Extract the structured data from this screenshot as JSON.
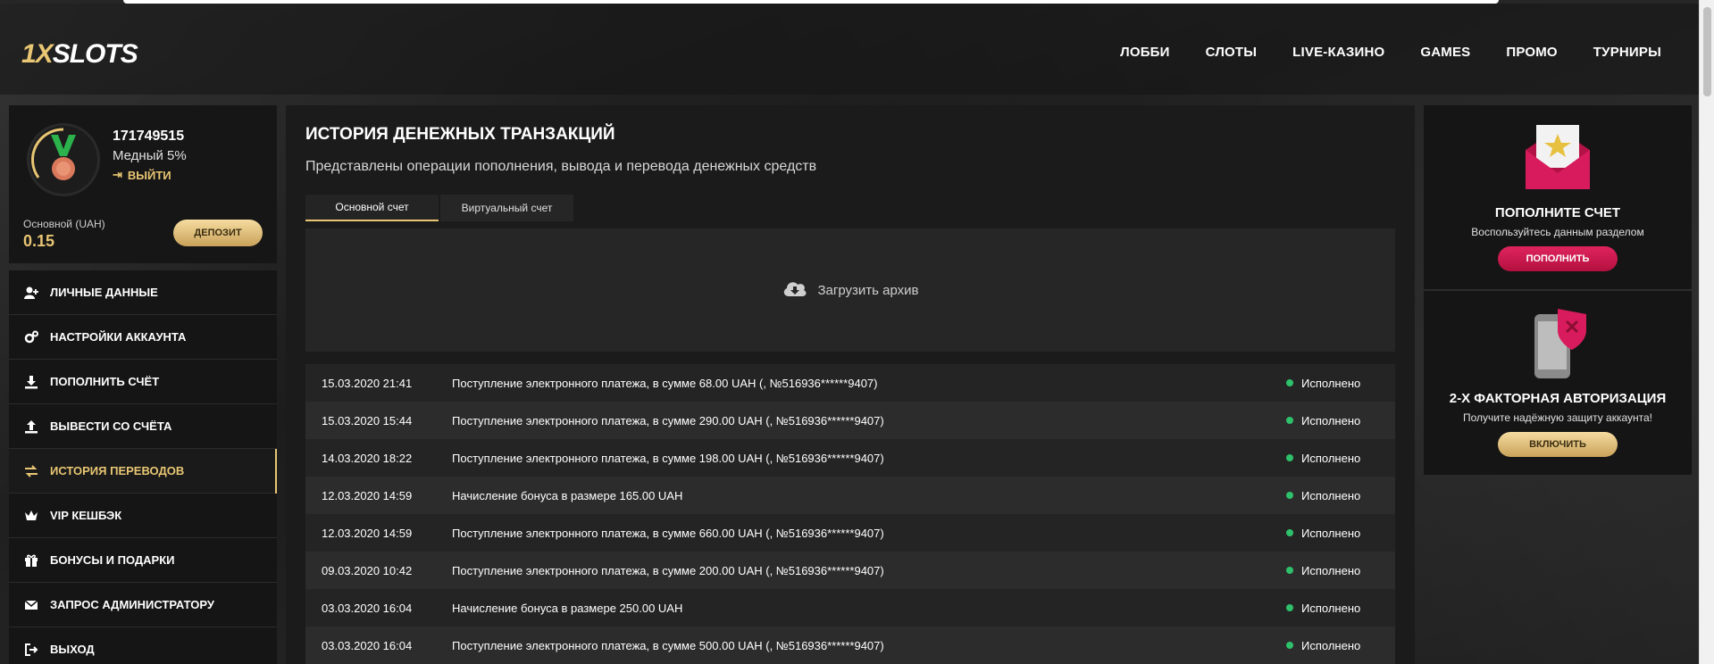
{
  "brand": {
    "logo_prefix": "1X",
    "logo_suffix": "SLOTS",
    "accent": "#e8c673"
  },
  "nav": [
    "ЛОББИ",
    "СЛОТЫ",
    "LIVE-КАЗИНО",
    "GAMES",
    "ПРОМО",
    "ТУРНИРЫ"
  ],
  "profile": {
    "user_id": "171749515",
    "level": "Медный 5%",
    "logout": "ВЫЙТИ",
    "balance_label": "Основной (UAH)",
    "balance_value": "0.15",
    "deposit_button": "ДЕПОЗИТ"
  },
  "menu": [
    {
      "label": "ЛИЧНЫЕ ДАННЫЕ",
      "icon": "user-plus-icon"
    },
    {
      "label": "НАСТРОЙКИ АККАУНТА",
      "icon": "gears-icon"
    },
    {
      "label": "ПОПОЛНИТЬ СЧЁТ",
      "icon": "download-icon"
    },
    {
      "label": "ВЫВЕСТИ СО СЧЁТА",
      "icon": "upload-icon"
    },
    {
      "label": "ИСТОРИЯ ПЕРЕВОДОВ",
      "icon": "exchange-icon",
      "active": true
    },
    {
      "label": "VIP КЕШБЭК",
      "icon": "crown-icon"
    },
    {
      "label": "БОНУСЫ И ПОДАРКИ",
      "icon": "gift-icon"
    },
    {
      "label": "ЗАПРОС АДМИНИСТРАТОРУ",
      "icon": "envelope-icon"
    },
    {
      "label": "ВЫХОД",
      "icon": "exit-icon"
    }
  ],
  "main": {
    "title": "ИСТОРИЯ ДЕНЕЖНЫХ ТРАНЗАКЦИЙ",
    "subtitle": "Представлены операции пополнения, вывода и перевода денежных средств",
    "tabs": [
      "Основной счет",
      "Виртуальный счет"
    ],
    "archive": "Загрузить архив",
    "transactions": [
      {
        "date": "15.03.2020 21:41",
        "desc": "Поступление электронного платежа, в сумме 68.00 UAH (, №516936******9407)",
        "status": "Исполнено"
      },
      {
        "date": "15.03.2020 15:44",
        "desc": "Поступление электронного платежа, в сумме 290.00 UAH (, №516936******9407)",
        "status": "Исполнено"
      },
      {
        "date": "14.03.2020 18:22",
        "desc": "Поступление электронного платежа, в сумме 198.00 UAH (, №516936******9407)",
        "status": "Исполнено"
      },
      {
        "date": "12.03.2020 14:59",
        "desc": "Начисление бонуса в размере 165.00 UAH",
        "status": "Исполнено"
      },
      {
        "date": "12.03.2020 14:59",
        "desc": "Поступление электронного платежа, в сумме 660.00 UAH (, №516936******9407)",
        "status": "Исполнено"
      },
      {
        "date": "09.03.2020 10:42",
        "desc": "Поступление электронного платежа, в сумме 200.00 UAH (, №516936******9407)",
        "status": "Исполнено"
      },
      {
        "date": "03.03.2020 16:04",
        "desc": "Начисление бонуса в размере 250.00 UAH",
        "status": "Исполнено"
      },
      {
        "date": "03.03.2020 16:04",
        "desc": "Поступление электронного платежа, в сумме 500.00 UAH (, №516936******9407)",
        "status": "Исполнено"
      }
    ]
  },
  "cards": {
    "deposit": {
      "title": "ПОПОЛНИТЕ СЧЕТ",
      "text": "Воспользуйтесь данным разделом",
      "button": "ПОПОЛНИТЬ"
    },
    "twofa": {
      "title": "2-Х ФАКТОРНАЯ АВТОРИЗАЦИЯ",
      "text": "Получите надёжную защиту аккаунта!",
      "button": "ВКЛЮЧИТЬ"
    }
  }
}
